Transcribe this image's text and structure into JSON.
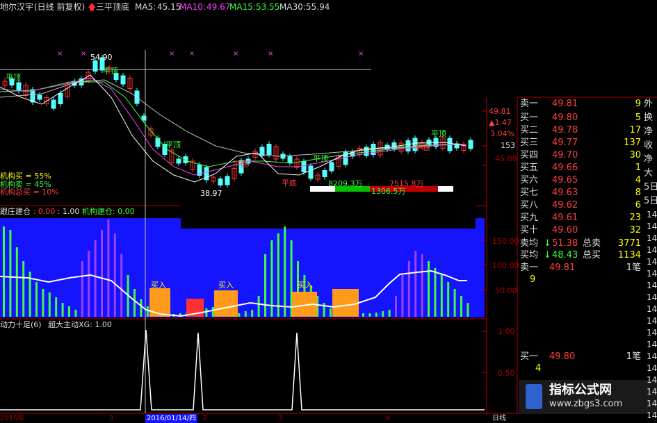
{
  "header": {
    "stock_name": "地尔汉宇",
    "mode": "(日线 前复权)",
    "signal": "三平顶底",
    "ma5_label": "MA5:",
    "ma5_value": "45.15",
    "ma10_label": "MA10:",
    "ma10_value": "49.67",
    "ma15_label": "MA15:",
    "ma15_value": "53.55",
    "ma30_label": "MA30:",
    "ma30_value": "55.94"
  },
  "colors": {
    "up": "#ff3030",
    "down": "#54ffff",
    "ma5": "#ffffff",
    "ma10": "#ff40ff",
    "ma15": "#3cff3c",
    "ma30": "#c0c0c0",
    "yellow": "#ffff00",
    "blue_bg": "#1414ff"
  },
  "main_panel": {
    "peak_price": "54.90",
    "low_price": "38.97",
    "pingding_labels": [
      "平顶",
      "平顶",
      "平顶",
      "平顶",
      "平顶"
    ],
    "pingdi_labels": [
      "平底",
      "平底",
      "平底"
    ],
    "inst_buy": "机构买 = 55%",
    "inst_sell": "机构卖 = 45%",
    "inst_total": "机构总买 = 10%",
    "vol_left": "8209.3万",
    "vol_right": "7515.8万",
    "vol_mid": "1306.5万",
    "axis": {
      "p1": "49.81",
      "p2": "▲1.47",
      "p3": "3.04%",
      "p4": "153",
      "p5": "45.00"
    }
  },
  "indicator1": {
    "title_a": "跟庄建仓",
    "title_b": ": 0.00",
    "title_c": ": 1.00",
    "title_d": "机构建仓: 0.00",
    "buy_labels": [
      "买入",
      "买入",
      "买入"
    ],
    "axis": {
      "a1": "150.00",
      "a2": "100.00",
      "a3": "50.00"
    }
  },
  "indicator2": {
    "title_a": "动力十足(6)",
    "title_b": "超大主动XG: 1.00",
    "axis": {
      "a1": "1.00",
      "a2": "0.50"
    }
  },
  "date_axis": {
    "start": "2015年",
    "m1": "3",
    "cursor": "2016/01/14/四",
    "m2": "2",
    "m3": "3",
    "m4": "4",
    "period": "日线"
  },
  "order_book": {
    "asks": [
      {
        "label": "卖一",
        "price": "49.81",
        "vol": "9"
      }
    ],
    "bids": [
      {
        "label": "买一",
        "price": "49.80",
        "vol": "5"
      },
      {
        "label": "买二",
        "price": "49.78",
        "vol": "17"
      },
      {
        "label": "买三",
        "price": "49.77",
        "vol": "137"
      },
      {
        "label": "买四",
        "price": "49.70",
        "vol": "30"
      },
      {
        "label": "买五",
        "price": "49.66",
        "vol": "1"
      },
      {
        "label": "买六",
        "price": "49.65",
        "vol": "4"
      },
      {
        "label": "买七",
        "price": "49.63",
        "vol": "8"
      },
      {
        "label": "买八",
        "price": "49.62",
        "vol": "6"
      },
      {
        "label": "买九",
        "price": "49.61",
        "vol": "23"
      },
      {
        "label": "买十",
        "price": "49.60",
        "vol": "32"
      }
    ],
    "avg_sell_label": "卖均",
    "avg_sell": "51.38",
    "total_sell_label": "总卖",
    "total_sell": "3771",
    "avg_buy_label": "买均",
    "avg_buy": "48.43",
    "total_buy_label": "总买",
    "total_buy": "1134",
    "queue_sell_label": "卖一",
    "queue_sell_price": "49.81",
    "queue_sell_unit": "1笔",
    "queue_sell_vol": "9",
    "queue_buy_label": "买一",
    "queue_buy_price": "49.80",
    "queue_buy_unit": "1笔",
    "queue_buy_vol": "4"
  },
  "right_stats": [
    "外",
    "换",
    "净",
    "收",
    "净",
    "大",
    "5日",
    "5日"
  ],
  "time_column": [
    "14",
    "14",
    "14",
    "14",
    "14",
    "14",
    "14",
    "14",
    "14",
    "14",
    "14",
    "14",
    "14",
    "14",
    "14",
    "14",
    "14",
    "14"
  ],
  "watermark": {
    "title": "指标公式网",
    "url": "www.zbgs3.com"
  }
}
